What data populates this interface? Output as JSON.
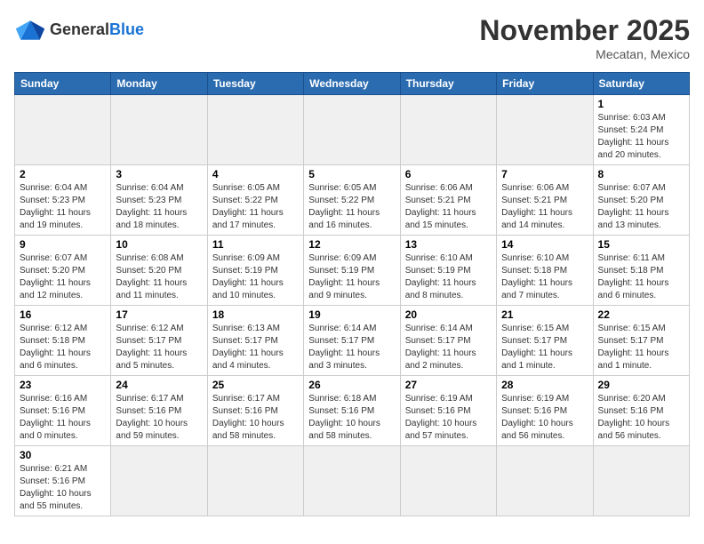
{
  "header": {
    "logo_general": "General",
    "logo_blue": "Blue",
    "main_title": "November 2025",
    "subtitle": "Mecatan, Mexico"
  },
  "days_of_week": [
    "Sunday",
    "Monday",
    "Tuesday",
    "Wednesday",
    "Thursday",
    "Friday",
    "Saturday"
  ],
  "weeks": [
    [
      {
        "day": "",
        "info": ""
      },
      {
        "day": "",
        "info": ""
      },
      {
        "day": "",
        "info": ""
      },
      {
        "day": "",
        "info": ""
      },
      {
        "day": "",
        "info": ""
      },
      {
        "day": "",
        "info": ""
      },
      {
        "day": "1",
        "info": "Sunrise: 6:03 AM\nSunset: 5:24 PM\nDaylight: 11 hours and 20 minutes."
      }
    ],
    [
      {
        "day": "2",
        "info": "Sunrise: 6:04 AM\nSunset: 5:23 PM\nDaylight: 11 hours and 19 minutes."
      },
      {
        "day": "3",
        "info": "Sunrise: 6:04 AM\nSunset: 5:23 PM\nDaylight: 11 hours and 18 minutes."
      },
      {
        "day": "4",
        "info": "Sunrise: 6:05 AM\nSunset: 5:22 PM\nDaylight: 11 hours and 17 minutes."
      },
      {
        "day": "5",
        "info": "Sunrise: 6:05 AM\nSunset: 5:22 PM\nDaylight: 11 hours and 16 minutes."
      },
      {
        "day": "6",
        "info": "Sunrise: 6:06 AM\nSunset: 5:21 PM\nDaylight: 11 hours and 15 minutes."
      },
      {
        "day": "7",
        "info": "Sunrise: 6:06 AM\nSunset: 5:21 PM\nDaylight: 11 hours and 14 minutes."
      },
      {
        "day": "8",
        "info": "Sunrise: 6:07 AM\nSunset: 5:20 PM\nDaylight: 11 hours and 13 minutes."
      }
    ],
    [
      {
        "day": "9",
        "info": "Sunrise: 6:07 AM\nSunset: 5:20 PM\nDaylight: 11 hours and 12 minutes."
      },
      {
        "day": "10",
        "info": "Sunrise: 6:08 AM\nSunset: 5:20 PM\nDaylight: 11 hours and 11 minutes."
      },
      {
        "day": "11",
        "info": "Sunrise: 6:09 AM\nSunset: 5:19 PM\nDaylight: 11 hours and 10 minutes."
      },
      {
        "day": "12",
        "info": "Sunrise: 6:09 AM\nSunset: 5:19 PM\nDaylight: 11 hours and 9 minutes."
      },
      {
        "day": "13",
        "info": "Sunrise: 6:10 AM\nSunset: 5:19 PM\nDaylight: 11 hours and 8 minutes."
      },
      {
        "day": "14",
        "info": "Sunrise: 6:10 AM\nSunset: 5:18 PM\nDaylight: 11 hours and 7 minutes."
      },
      {
        "day": "15",
        "info": "Sunrise: 6:11 AM\nSunset: 5:18 PM\nDaylight: 11 hours and 6 minutes."
      }
    ],
    [
      {
        "day": "16",
        "info": "Sunrise: 6:12 AM\nSunset: 5:18 PM\nDaylight: 11 hours and 6 minutes."
      },
      {
        "day": "17",
        "info": "Sunrise: 6:12 AM\nSunset: 5:17 PM\nDaylight: 11 hours and 5 minutes."
      },
      {
        "day": "18",
        "info": "Sunrise: 6:13 AM\nSunset: 5:17 PM\nDaylight: 11 hours and 4 minutes."
      },
      {
        "day": "19",
        "info": "Sunrise: 6:14 AM\nSunset: 5:17 PM\nDaylight: 11 hours and 3 minutes."
      },
      {
        "day": "20",
        "info": "Sunrise: 6:14 AM\nSunset: 5:17 PM\nDaylight: 11 hours and 2 minutes."
      },
      {
        "day": "21",
        "info": "Sunrise: 6:15 AM\nSunset: 5:17 PM\nDaylight: 11 hours and 1 minute."
      },
      {
        "day": "22",
        "info": "Sunrise: 6:15 AM\nSunset: 5:17 PM\nDaylight: 11 hours and 1 minute."
      }
    ],
    [
      {
        "day": "23",
        "info": "Sunrise: 6:16 AM\nSunset: 5:16 PM\nDaylight: 11 hours and 0 minutes."
      },
      {
        "day": "24",
        "info": "Sunrise: 6:17 AM\nSunset: 5:16 PM\nDaylight: 10 hours and 59 minutes."
      },
      {
        "day": "25",
        "info": "Sunrise: 6:17 AM\nSunset: 5:16 PM\nDaylight: 10 hours and 58 minutes."
      },
      {
        "day": "26",
        "info": "Sunrise: 6:18 AM\nSunset: 5:16 PM\nDaylight: 10 hours and 58 minutes."
      },
      {
        "day": "27",
        "info": "Sunrise: 6:19 AM\nSunset: 5:16 PM\nDaylight: 10 hours and 57 minutes."
      },
      {
        "day": "28",
        "info": "Sunrise: 6:19 AM\nSunset: 5:16 PM\nDaylight: 10 hours and 56 minutes."
      },
      {
        "day": "29",
        "info": "Sunrise: 6:20 AM\nSunset: 5:16 PM\nDaylight: 10 hours and 56 minutes."
      }
    ],
    [
      {
        "day": "30",
        "info": "Sunrise: 6:21 AM\nSunset: 5:16 PM\nDaylight: 10 hours and 55 minutes."
      },
      {
        "day": "",
        "info": ""
      },
      {
        "day": "",
        "info": ""
      },
      {
        "day": "",
        "info": ""
      },
      {
        "day": "",
        "info": ""
      },
      {
        "day": "",
        "info": ""
      },
      {
        "day": "",
        "info": ""
      }
    ]
  ]
}
